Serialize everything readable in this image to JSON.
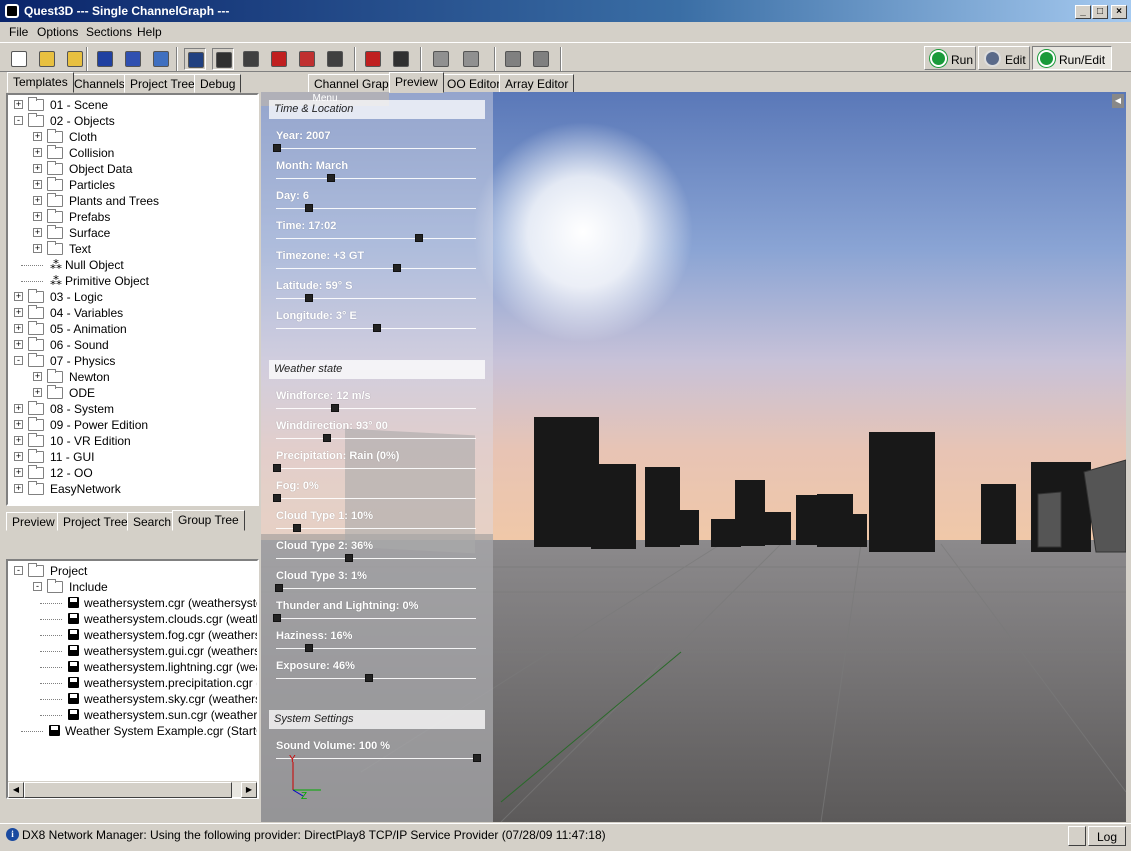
{
  "window": {
    "title": "Quest3D  ---  Single ChannelGraph  ---",
    "buttons": {
      "minimize": "_",
      "maximize": "□",
      "close": "×"
    }
  },
  "menu": [
    "File",
    "Options",
    "Sections",
    "Help"
  ],
  "toolbar": {
    "buttons": [
      {
        "name": "new-icon",
        "color": "#ffffff"
      },
      {
        "name": "open-folder-icon",
        "color": "#e8c040"
      },
      {
        "name": "open-folder-2-icon",
        "color": "#e8c040"
      },
      {
        "name": "save-icon",
        "color": "#2040a0"
      },
      {
        "name": "save-all-icon",
        "color": "#3050b0"
      },
      {
        "name": "copy-icon",
        "color": "#4070c0"
      },
      {
        "name": "channel-icon",
        "color": "#204080"
      },
      {
        "name": "filmstrip-icon",
        "color": "#303030"
      },
      {
        "name": "link-icon",
        "color": "#404040"
      },
      {
        "name": "red-cube-icon",
        "color": "#c02020"
      },
      {
        "name": "connect-icon",
        "color": "#c03030"
      },
      {
        "name": "list-icon",
        "color": "#404040"
      },
      {
        "name": "bug-icon",
        "color": "#c02020"
      },
      {
        "name": "pin-icon",
        "color": "#303030"
      },
      {
        "name": "cubes-icon",
        "color": "#909090"
      },
      {
        "name": "cubes-2-icon",
        "color": "#909090"
      },
      {
        "name": "key-icon",
        "color": "#808080"
      },
      {
        "name": "key-2-icon",
        "color": "#808080"
      }
    ],
    "run": "Run",
    "edit": "Edit",
    "run_edit": "Run/Edit"
  },
  "left_tabs": [
    "Templates",
    "Channels",
    "Project Tree",
    "Debug"
  ],
  "center_tabs": [
    "Channel Graph",
    "Preview",
    "OO Editor",
    "Array Editor"
  ],
  "templates_tree": [
    {
      "label": "01 - Scene",
      "level": 0,
      "expand": "+",
      "icon": "folder"
    },
    {
      "label": "02 - Objects",
      "level": 0,
      "expand": "-",
      "icon": "folder"
    },
    {
      "label": "Cloth",
      "level": 1,
      "expand": "+",
      "icon": "folder"
    },
    {
      "label": "Collision",
      "level": 1,
      "expand": "+",
      "icon": "folder"
    },
    {
      "label": "Object Data",
      "level": 1,
      "expand": "+",
      "icon": "folder"
    },
    {
      "label": "Particles",
      "level": 1,
      "expand": "+",
      "icon": "folder"
    },
    {
      "label": "Plants and Trees",
      "level": 1,
      "expand": "+",
      "icon": "folder"
    },
    {
      "label": "Prefabs",
      "level": 1,
      "expand": "+",
      "icon": "folder"
    },
    {
      "label": "Surface",
      "level": 1,
      "expand": "+",
      "icon": "folder"
    },
    {
      "label": "Text",
      "level": 1,
      "expand": "+",
      "icon": "folder"
    },
    {
      "label": "Null Object",
      "level": 1,
      "expand": "",
      "icon": "node"
    },
    {
      "label": "Primitive Object",
      "level": 1,
      "expand": "",
      "icon": "node"
    },
    {
      "label": "03 - Logic",
      "level": 0,
      "expand": "+",
      "icon": "folder"
    },
    {
      "label": "04 - Variables",
      "level": 0,
      "expand": "+",
      "icon": "folder"
    },
    {
      "label": "05 - Animation",
      "level": 0,
      "expand": "+",
      "icon": "folder"
    },
    {
      "label": "06 - Sound",
      "level": 0,
      "expand": "+",
      "icon": "folder"
    },
    {
      "label": "07 - Physics",
      "level": 0,
      "expand": "-",
      "icon": "folder"
    },
    {
      "label": "Newton",
      "level": 1,
      "expand": "+",
      "icon": "folder"
    },
    {
      "label": "ODE",
      "level": 1,
      "expand": "+",
      "icon": "folder"
    },
    {
      "label": "08 - System",
      "level": 0,
      "expand": "+",
      "icon": "folder"
    },
    {
      "label": "09 - Power Edition",
      "level": 0,
      "expand": "+",
      "icon": "folder"
    },
    {
      "label": "10 - VR Edition",
      "level": 0,
      "expand": "+",
      "icon": "folder"
    },
    {
      "label": "11 - GUI",
      "level": 0,
      "expand": "+",
      "icon": "folder"
    },
    {
      "label": "12 - OO",
      "level": 0,
      "expand": "+",
      "icon": "folder"
    },
    {
      "label": "EasyNetwork",
      "level": 0,
      "expand": "+",
      "icon": "folder"
    }
  ],
  "bottom_tabs": [
    "Preview",
    "Project Tree",
    "Search",
    "Group Tree"
  ],
  "group_tree": [
    {
      "label": "Project",
      "level": 0,
      "expand": "-",
      "icon": "folder"
    },
    {
      "label": "Include",
      "level": 1,
      "expand": "-",
      "icon": "folder"
    },
    {
      "label": "weathersystem.cgr (weathersystem)",
      "level": 2,
      "expand": "",
      "icon": "disk"
    },
    {
      "label": "weathersystem.clouds.cgr (weathersystem)",
      "level": 2,
      "expand": "",
      "icon": "disk"
    },
    {
      "label": "weathersystem.fog.cgr (weathersystem)",
      "level": 2,
      "expand": "",
      "icon": "disk"
    },
    {
      "label": "weathersystem.gui.cgr (weathersystem)",
      "level": 2,
      "expand": "",
      "icon": "disk"
    },
    {
      "label": "weathersystem.lightning.cgr (weathersystem)",
      "level": 2,
      "expand": "",
      "icon": "disk"
    },
    {
      "label": "weathersystem.precipitation.cgr (weathersystem)",
      "level": 2,
      "expand": "",
      "icon": "disk"
    },
    {
      "label": "weathersystem.sky.cgr (weathersystem)",
      "level": 2,
      "expand": "",
      "icon": "disk"
    },
    {
      "label": "weathersystem.sun.cgr (weathersystem)",
      "level": 2,
      "expand": "",
      "icon": "disk"
    },
    {
      "label": "Weather System Example.cgr (StartGroup)",
      "level": 1,
      "expand": "",
      "icon": "disk"
    }
  ],
  "preview_menu": {
    "menu_label": "Menu",
    "sections": [
      {
        "title": "Time & Location",
        "sliders": [
          {
            "label": "Year: 2007",
            "value": 0.0
          },
          {
            "label": "Month: March",
            "value": 0.27
          },
          {
            "label": "Day: 6",
            "value": 0.16
          },
          {
            "label": "Time: 17:02",
            "value": 0.71
          },
          {
            "label": "Timezone: +3 GT",
            "value": 0.6
          },
          {
            "label": "Latitude: 59° S",
            "value": 0.16
          },
          {
            "label": "Longitude: 3° E",
            "value": 0.5
          }
        ]
      },
      {
        "title": "Weather state",
        "sliders": [
          {
            "label": "Windforce: 12 m/s",
            "value": 0.29
          },
          {
            "label": "Winddirection: 93° 00",
            "value": 0.25
          },
          {
            "label": "Precipitation: Rain (0%)",
            "value": 0.0
          },
          {
            "label": "Fog: 0%",
            "value": 0.0
          },
          {
            "label": "Cloud Type 1: 10%",
            "value": 0.1
          },
          {
            "label": "Cloud Type 2: 36%",
            "value": 0.36
          },
          {
            "label": "Cloud Type 3: 1%",
            "value": 0.01
          },
          {
            "label": "Thunder and Lightning: 0%",
            "value": 0.0
          },
          {
            "label": "Haziness: 16%",
            "value": 0.16
          },
          {
            "label": "Exposure: 46%",
            "value": 0.46
          }
        ]
      },
      {
        "title": "System Settings",
        "sliders": [
          {
            "label": "Sound Volume: 100 %",
            "value": 1.0
          }
        ]
      }
    ],
    "axis": {
      "y": "Y",
      "z": "Z"
    }
  },
  "status": {
    "message": "DX8 Network Manager: Using the following provider:  DirectPlay8 TCP/IP Service Provider (07/28/09 11:47:18)",
    "log": "Log"
  }
}
